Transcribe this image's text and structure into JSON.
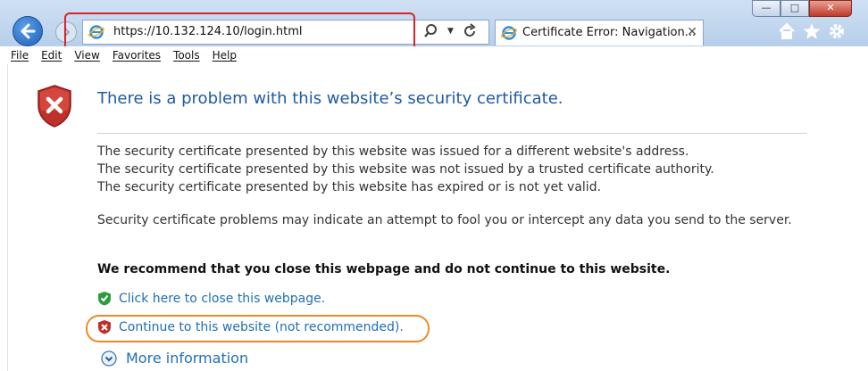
{
  "browser": {
    "url": "https://10.132.124.10/login.html",
    "tab_title": "Certificate Error: Navigation...",
    "window_buttons": {
      "minimize": "—",
      "maximize": "□",
      "close": "✕"
    }
  },
  "menu": [
    "File",
    "Edit",
    "View",
    "Favorites",
    "Tools",
    "Help"
  ],
  "page": {
    "heading": "There is a problem with this website’s security certificate.",
    "reasons": [
      "The security certificate presented by this website was issued for a different website's address.",
      "The security certificate presented by this website was not issued by a trusted certificate authority.",
      "The security certificate presented by this website has expired or is not yet valid."
    ],
    "warning": "Security certificate problems may indicate an attempt to fool you or intercept any data you send to the server.",
    "recommendation": "We recommend that you close this webpage and do not continue to this website.",
    "close_link": "Click here to close this webpage.",
    "continue_link": "Continue to this website (not recommended).",
    "more_info": "More information"
  },
  "colors": {
    "link": "#1f6fb7",
    "heading": "#1f5aa5",
    "annotation_red": "#d9222a",
    "annotation_orange": "#f08a24"
  }
}
